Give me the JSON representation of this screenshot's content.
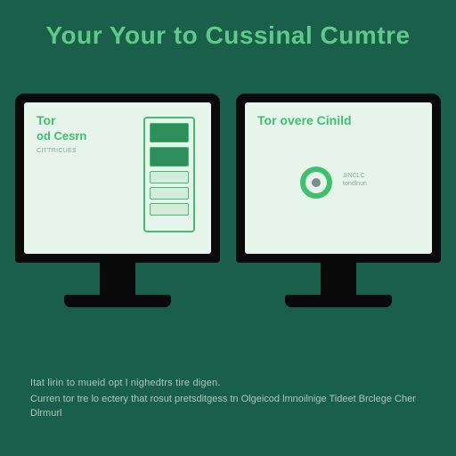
{
  "title": "Your Your to Cussinal Cumtre",
  "left_screen": {
    "line1": "Tor",
    "line2": "od Cesrn",
    "sub": "CITTRICUES"
  },
  "right_screen": {
    "line1": "Tor overe Cinild",
    "circ_label1": "JINCLC",
    "circ_label2": "tondlnun"
  },
  "footer": {
    "line1": "Itat lirin to mueid opt l nighedtrs tire digen.",
    "line2": "Curren tor tre lo ectery that rosut pretsditgess tn Olgeicod lmnoilnige Tideet Brclege Cher Dlrmurl"
  }
}
